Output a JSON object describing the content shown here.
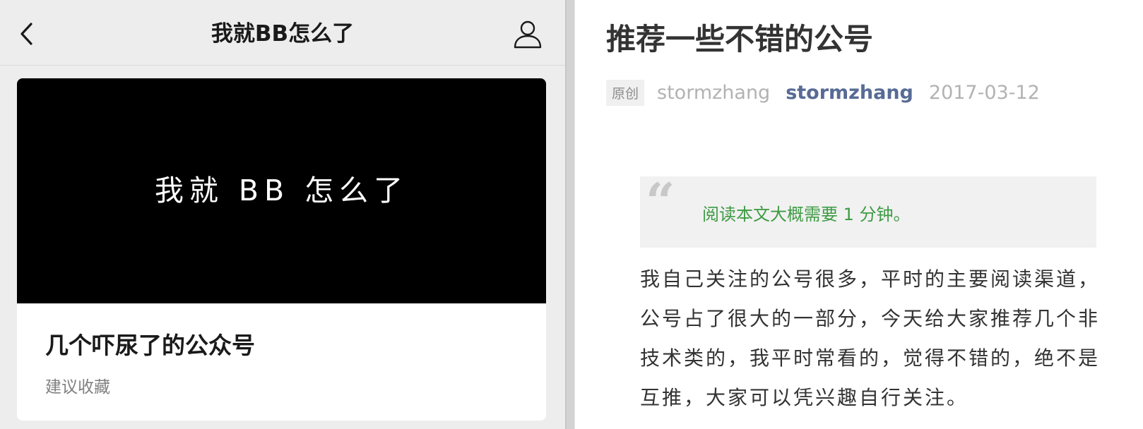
{
  "left": {
    "nav": {
      "back_icon": "back-chevron-icon",
      "title": "我就BB怎么了",
      "profile_icon": "person-icon"
    },
    "card": {
      "cover_text": "我就 BB 怎么了",
      "title": "几个吓尿了的公众号",
      "subtitle": "建议收藏"
    }
  },
  "right": {
    "article": {
      "title": "推荐一些不错的公号",
      "badge": "原创",
      "author": "stormzhang",
      "account": "stormzhang",
      "date": "2017-03-12",
      "quote_icon": "quote-mark-icon",
      "quote_text": "阅读本文大概需要 1 分钟。",
      "body": "我自己关注的公号很多，平时的主要阅读渠道，公号占了很大的一部分，今天给大家推荐几个非技术类的，我平时常看的，觉得不错的，绝不是互推，大家可以凭兴趣自行关注。"
    }
  },
  "colors": {
    "link_blue": "#576b95",
    "quote_green": "#3e9b44",
    "panel_gray": "#ededed"
  }
}
